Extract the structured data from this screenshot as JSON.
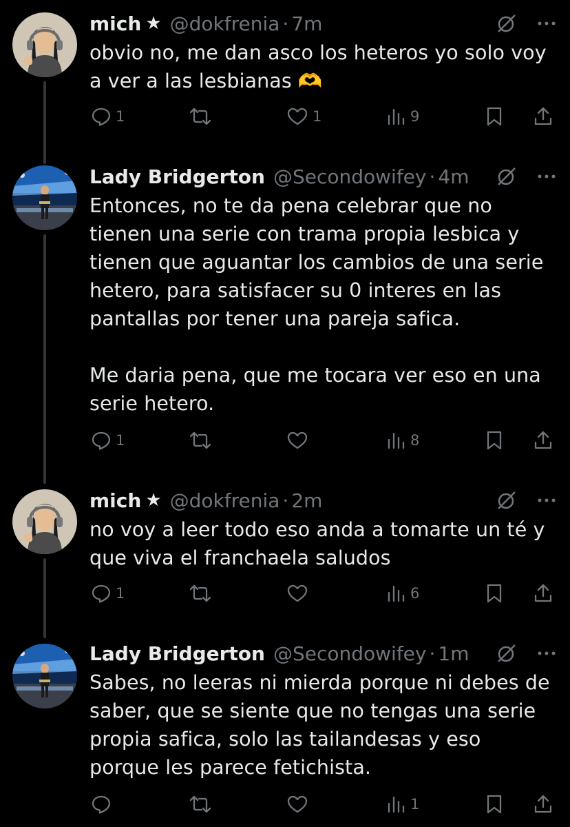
{
  "tweets": [
    {
      "name": "mich",
      "verified_star": "★",
      "handle": "@dokfrenia",
      "sep": "·",
      "time": "7m",
      "text": "obvio no, me dan asco los heteros yo solo voy\na ver a las lesbianas 🫶",
      "replies": "1",
      "retweets": "",
      "likes": "1",
      "views": "9",
      "avatar": "anime-avatar-headphones"
    },
    {
      "name": "Lady Bridgerton",
      "verified_star": "",
      "handle": "@Secondowifey",
      "sep": "·",
      "time": "4m",
      "text": "Entonces, no te da pena celebrar que no\ntienen una serie con trama propia lesbica y\ntienen que aguantar los cambios de una serie\nhetero, para satisfacer su 0 interes en las\npantallas por tener una pareja safica.\n\nMe daria pena, que me tocara ver eso en una\nserie hetero.",
      "replies": "1",
      "retweets": "",
      "likes": "",
      "views": "8",
      "avatar": "wrestling-arena-avatar"
    },
    {
      "name": "mich",
      "verified_star": "★",
      "handle": "@dokfrenia",
      "sep": "·",
      "time": "2m",
      "text": "no voy a leer todo eso anda a tomarte un té y\nque viva el franchaela saludos",
      "replies": "1",
      "retweets": "",
      "likes": "",
      "views": "6",
      "avatar": "anime-avatar-headphones"
    },
    {
      "name": "Lady Bridgerton",
      "verified_star": "",
      "handle": "@Secondowifey",
      "sep": "·",
      "time": "1m",
      "text": "Sabes, no leeras ni mierda porque ni debes de\nsaber, que se siente que no tengas una serie\npropia safica, solo las tailandesas y eso\nporque les parece fetichista.",
      "replies": "",
      "retweets": "",
      "likes": "",
      "views": "1",
      "avatar": "wrestling-arena-avatar"
    }
  ],
  "icons": {
    "reply": "reply-icon",
    "retweet": "retweet-icon",
    "like": "heart-icon",
    "views": "views-icon",
    "bookmark": "bookmark-icon",
    "share": "share-icon",
    "grok": "grok-icon",
    "more": "more-icon"
  },
  "colors": {
    "background": "#000000",
    "text": "#e7e9ea",
    "secondary": "#71767b",
    "thread_line": "#333639"
  }
}
